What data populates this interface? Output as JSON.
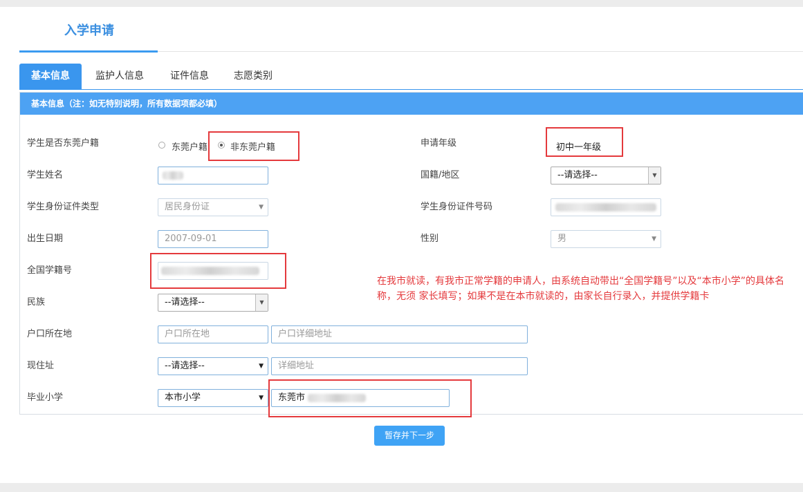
{
  "page": {
    "title": "入学申请"
  },
  "tabs": [
    {
      "label": "基本信息",
      "active": true
    },
    {
      "label": "监护人信息",
      "active": false
    },
    {
      "label": "证件信息",
      "active": false
    },
    {
      "label": "志愿类别",
      "active": false
    }
  ],
  "panel": {
    "heading": "基本信息（注：如无特别说明，所有数据项都必填）"
  },
  "form": {
    "hukou": {
      "label": "学生是否东莞户籍",
      "options": [
        "东莞户籍",
        "非东莞户籍"
      ],
      "selected": "非东莞户籍"
    },
    "grade": {
      "label": "申请年级",
      "value": "初中一年级"
    },
    "student_name": {
      "label": "学生姓名"
    },
    "nationality": {
      "label": "国籍/地区",
      "value": "--请选择--"
    },
    "id_type": {
      "label": "学生身份证件类型",
      "value": "居民身份证"
    },
    "id_number": {
      "label": "学生身份证件号码"
    },
    "birth_date": {
      "label": "出生日期",
      "value": "2007-09-01"
    },
    "gender": {
      "label": "性别",
      "value": "男"
    },
    "national_student_no": {
      "label": "全国学籍号"
    },
    "ethnicity": {
      "label": "民族",
      "value": "--请选择--"
    },
    "household": {
      "label": "户口所在地",
      "placeholder": "户口所在地",
      "detail_placeholder": "户口详细地址"
    },
    "residence": {
      "label": "现住址",
      "value": "--请选择--",
      "detail_placeholder": "详细地址"
    },
    "primary_school": {
      "label": "毕业小学",
      "select_value": "本市小学",
      "name_value": "东莞市"
    }
  },
  "annotation": {
    "text": "在我市就读，有我市正常学籍的申请人，由系统自动带出“全国学籍号”以及“本市小学”的具体名称，无须 家长填写；如果不是在本市就读的，由家长自行录入，并提供学籍卡",
    "color": "#e4393c"
  },
  "buttons": {
    "next": "暂存并下一步"
  },
  "colors": {
    "accent": "#3a96ee",
    "annotation": "#e4393c"
  }
}
